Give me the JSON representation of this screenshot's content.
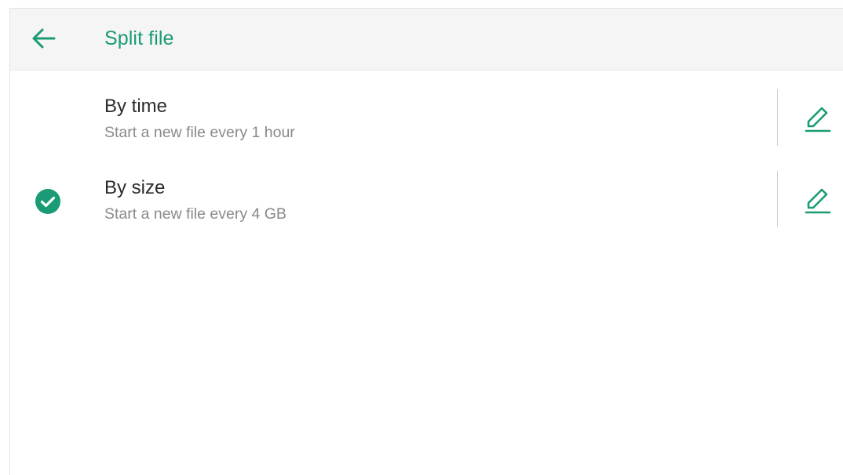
{
  "colors": {
    "accent": "#1a9b76",
    "header_bg": "#f5f5f5",
    "primary_text": "#2b2b2b",
    "secondary_text": "#8a8a8a"
  },
  "header": {
    "back_icon": "arrow-left-icon",
    "title": "Split file"
  },
  "options": [
    {
      "title": "By time",
      "subtitle": "Start a new file every 1 hour",
      "selected": false,
      "edit_icon": "pencil-icon"
    },
    {
      "title": "By size",
      "subtitle": "Start a new file every 4 GB",
      "selected": true,
      "selected_icon": "check-circle-icon",
      "edit_icon": "pencil-icon"
    }
  ]
}
